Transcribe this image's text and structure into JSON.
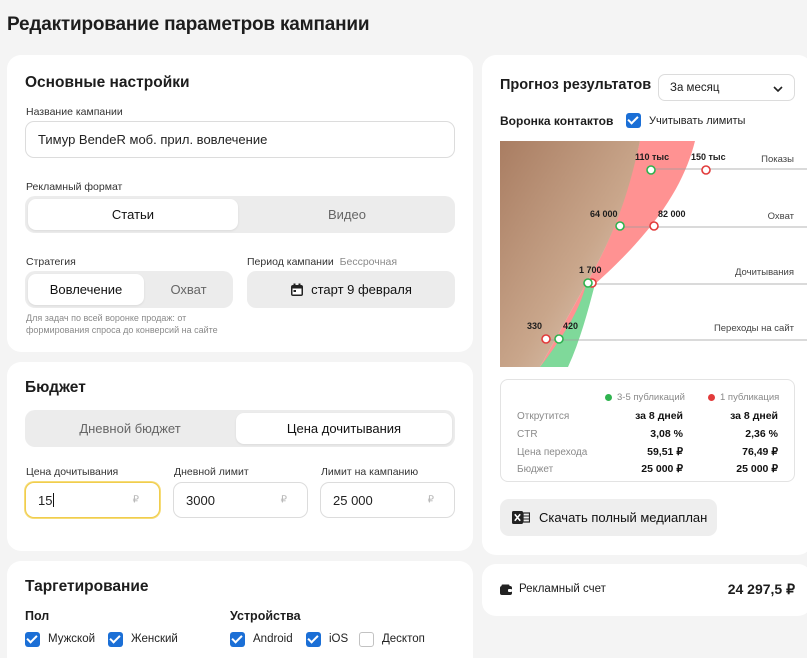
{
  "page_title": "Редактирование параметров кампании",
  "main": {
    "title": "Основные настройки",
    "name_label": "Название кампании",
    "name_value": "Тимур BendeR моб. прил. вовлечение",
    "format_label": "Рекламный формат",
    "format_options": [
      "Статьи",
      "Видео"
    ],
    "strategy_label": "Стратегия",
    "strategy_options": [
      "Вовлечение",
      "Охват"
    ],
    "strategy_hint": "Для задач по всей воронке продаж: от формирования спроса до конверсий на сайте",
    "period_label": "Период кампании",
    "period_sub": "Бессрочная",
    "period_value": "старт 9 февраля"
  },
  "budget": {
    "title": "Бюджет",
    "tabs": [
      "Дневной бюджет",
      "Цена дочитывания"
    ],
    "price_label": "Цена дочитывания",
    "price_value": "15",
    "daily_label": "Дневной лимит",
    "daily_value": "3000",
    "campaign_label": "Лимит на кампанию",
    "campaign_value": "25 000",
    "currency": "₽"
  },
  "targeting": {
    "title": "Таргетирование",
    "gender_label": "Пол",
    "gender": [
      {
        "label": "Мужской",
        "checked": true
      },
      {
        "label": "Женский",
        "checked": true
      }
    ],
    "devices_label": "Устройства",
    "devices": [
      {
        "label": "Android",
        "checked": true
      },
      {
        "label": "iOS",
        "checked": true
      },
      {
        "label": "Десктоп",
        "checked": false
      }
    ]
  },
  "forecast": {
    "title": "Прогноз результатов",
    "period_select": "За месяц",
    "funnel_title": "Воронка контактов",
    "limits_label": "Учитывать лимиты",
    "limits_checked": true,
    "stage_labels": [
      "Показы",
      "Охват",
      "Дочитывания",
      "Переходы на сайт"
    ],
    "green_values": [
      "110 тыс",
      "64 000",
      "1 700",
      "420"
    ],
    "red_values": [
      "150 тыс",
      "82 000",
      "",
      "330"
    ],
    "legend": [
      "3-5 публикаций",
      "1 публикация"
    ],
    "colors": {
      "green": "#2fb34f",
      "red": "#e23b3b",
      "accent": "#1b6fd6"
    },
    "table": [
      {
        "label": "Открутится",
        "a": "за 8 дней",
        "b": "за 8 дней"
      },
      {
        "label": "CTR",
        "a": "3,08 %",
        "b": "2,36 %"
      },
      {
        "label": "Цена перехода",
        "a": "59,51 ₽",
        "b": "76,49 ₽"
      },
      {
        "label": "Бюджет",
        "a": "25 000 ₽",
        "b": "25 000 ₽"
      }
    ],
    "download_label": "Скачать полный медиаплан"
  },
  "account": {
    "label": "Рекламный счет",
    "value": "24 297,5 ₽"
  }
}
